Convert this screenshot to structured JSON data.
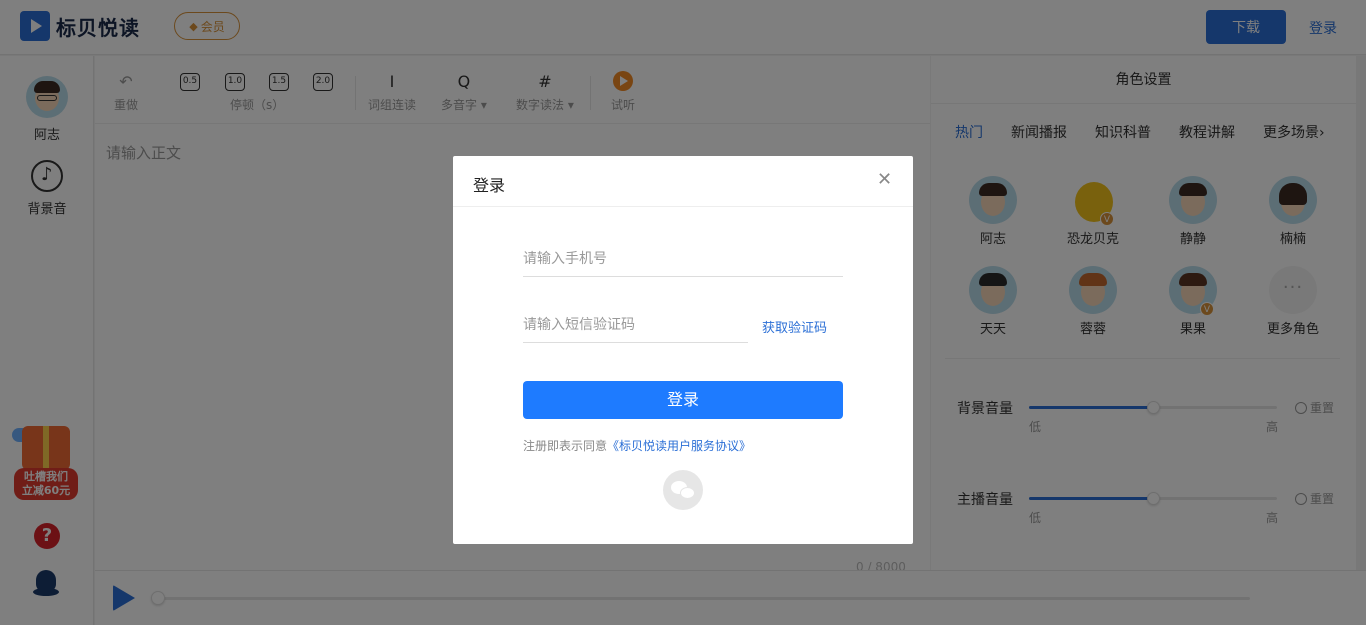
{
  "header": {
    "brand": "标贝悦读",
    "vip_label": "会员",
    "download_label": "下载",
    "login_label": "登录"
  },
  "sidebar": {
    "voice_label": "阿志",
    "bgm_label": "背景音",
    "promo_line1": "吐槽我们",
    "promo_line2": "立减60元"
  },
  "toolbar": {
    "redo": "重做",
    "speeds": [
      "0.5",
      "1.0",
      "1.5",
      "2.0"
    ],
    "pause_label": "停顿（s）",
    "word_link": "词组连读",
    "polyphone": "多音字",
    "number_read": "数字读法",
    "preview": "试听"
  },
  "editor": {
    "placeholder": "请输入正文",
    "count": "0 / 8000"
  },
  "right_panel": {
    "title": "角色设置",
    "categories": [
      "热门",
      "新闻播报",
      "知识科普",
      "教程讲解",
      "更多场景"
    ],
    "voices": [
      "阿志",
      "恐龙贝克",
      "静静",
      "楠楠",
      "天天",
      "蓉蓉",
      "果果",
      "更多角色"
    ],
    "vip_mark": "V",
    "bg_volume_label": "背景音量",
    "host_volume_label": "主播音量",
    "low": "低",
    "high": "高",
    "reset": "重置",
    "bg_volume_level": 0.5,
    "host_volume_level": 0.5
  },
  "modal": {
    "title": "登录",
    "phone_placeholder": "请输入手机号",
    "code_placeholder": "请输入短信验证码",
    "get_code": "获取验证码",
    "submit": "登录",
    "agree_prefix": "注册即表示同意",
    "agree_link": "《标贝悦读用户服务协议》"
  },
  "colors": {
    "brand_blue": "#2b6fd6",
    "button_blue": "#1e7bff",
    "vip_gold": "#d8933b",
    "preview_orange": "#f28a24"
  }
}
